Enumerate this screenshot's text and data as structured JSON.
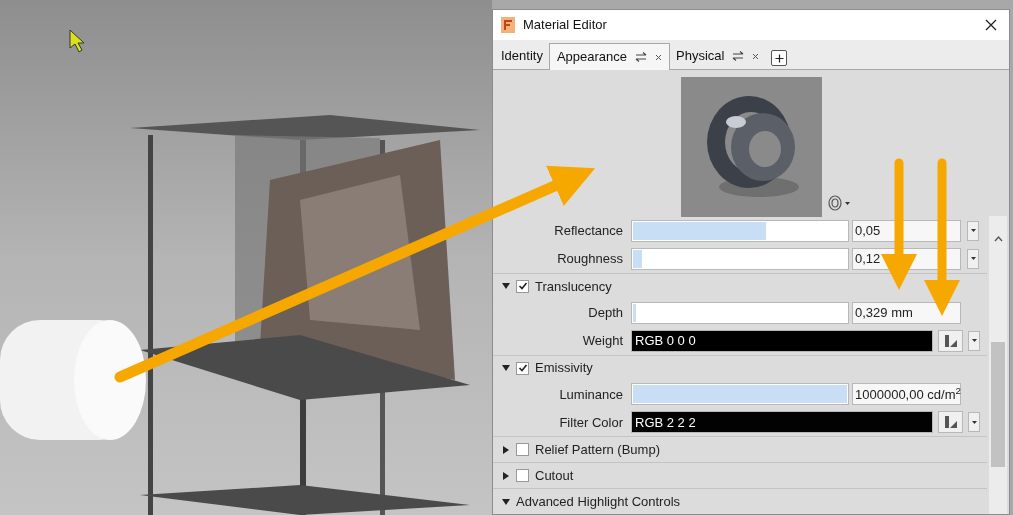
{
  "window": {
    "title": "Material Editor"
  },
  "tabs": [
    {
      "label": "Identity",
      "selected": false,
      "closable": false
    },
    {
      "label": "Appearance",
      "selected": true,
      "closable": true
    },
    {
      "label": "Physical",
      "selected": false,
      "closable": true
    }
  ],
  "properties": [
    {
      "kind": "slider",
      "label": "Reflectance",
      "level": 0.62,
      "value": "0,05",
      "menu": true
    },
    {
      "kind": "slider",
      "label": "Roughness",
      "level": 0.04,
      "value": "0,12",
      "menu": true
    },
    {
      "kind": "section",
      "label": "Translucency",
      "checked": true,
      "expanded": true
    },
    {
      "kind": "slider",
      "label": "Depth",
      "level": 0.01,
      "value": "0,329 mm",
      "menu": false
    },
    {
      "kind": "color",
      "label": "Weight",
      "value": "RGB 0 0 0",
      "color": "#000000"
    },
    {
      "kind": "section",
      "label": "Emissivity",
      "checked": true,
      "expanded": true
    },
    {
      "kind": "slider",
      "label": "Luminance",
      "level": 1,
      "value": "1000000,00 cd/m$^{2}$",
      "menu": false
    },
    {
      "kind": "color",
      "label": "Filter Color",
      "value": "RGB 2 2 2",
      "color": "#020202"
    },
    {
      "kind": "section",
      "label": "Relief Pattern (Bump)",
      "checked": false,
      "expanded": false
    },
    {
      "kind": "section",
      "label": "Cutout",
      "checked": false,
      "expanded": false
    },
    {
      "kind": "section",
      "label": "Advanced Highlight Controls",
      "expanded": true
    }
  ]
}
